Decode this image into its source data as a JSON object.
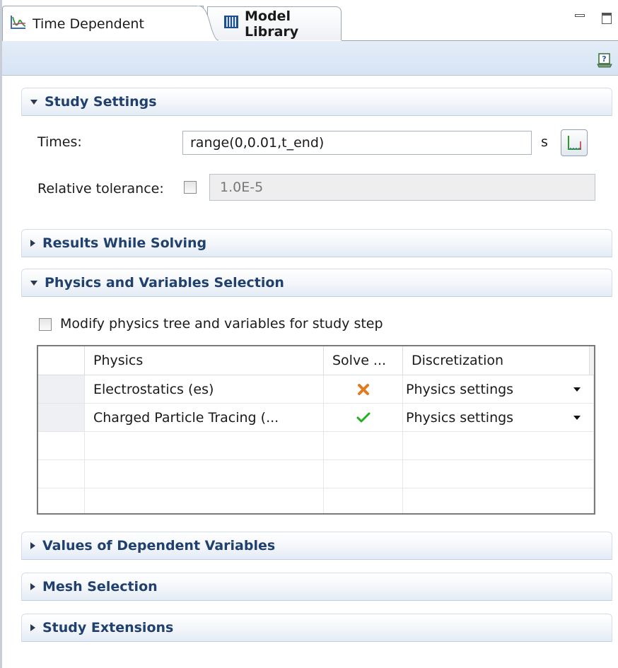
{
  "tabs": [
    {
      "label": "Time Dependent",
      "icon": "time-dependent-plot-icon",
      "active": true
    },
    {
      "label": "Model Library",
      "icon": "model-library-icon",
      "active": false
    }
  ],
  "toolbar": {
    "help_icon": "help-icon"
  },
  "study_settings": {
    "header": "Study Settings",
    "times_label": "Times:",
    "times_value": "range(0,0.01,t_end)",
    "times_unit": "s",
    "range_button_icon": "range-plot-icon",
    "tolerance_label": "Relative tolerance:",
    "tolerance_checked": false,
    "tolerance_value": "1.0E-5"
  },
  "sections": {
    "results_while_solving": "Results While Solving",
    "physics_variables": "Physics and Variables Selection",
    "values_dependent": "Values of Dependent Variables",
    "mesh_selection": "Mesh Selection",
    "study_extensions": "Study Extensions"
  },
  "physics_selection": {
    "modify_label": "Modify physics tree and variables for study step",
    "modify_checked": false,
    "columns": [
      "Physics",
      "Solve ...",
      "Discretization"
    ],
    "rows": [
      {
        "physics": "Electrostatics (es)",
        "solve": "disabled",
        "discretization": "Physics settings"
      },
      {
        "physics": "Charged Particle Tracing (...",
        "solve": "enabled",
        "discretization": "Physics settings"
      }
    ]
  },
  "colors": {
    "cross": "#e07b20",
    "check": "#22b022",
    "section_title": "#20406e"
  }
}
